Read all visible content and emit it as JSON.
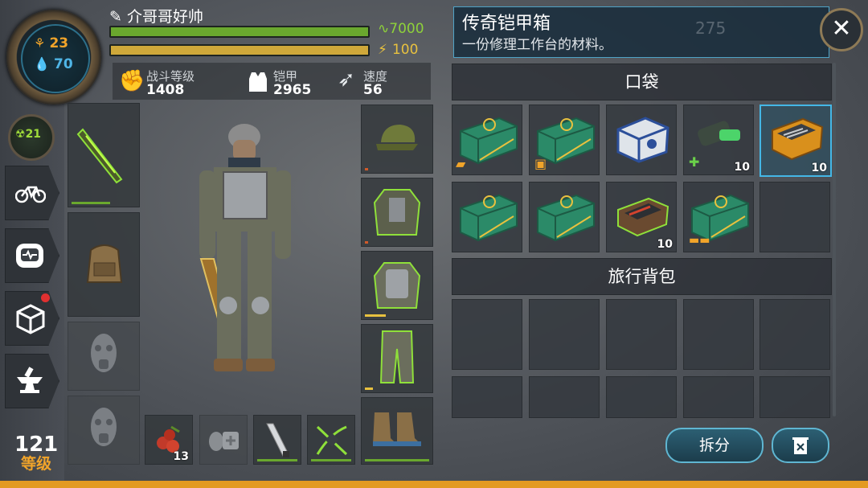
{
  "player": {
    "name": "介哥哥好帅",
    "hunger": "23",
    "thirst": "70",
    "radiation": "21",
    "level": "121",
    "level_label": "等级"
  },
  "bars": {
    "health": "7000",
    "energy": "100"
  },
  "stats": [
    {
      "label": "战斗等级",
      "value": "1408"
    },
    {
      "label": "铠甲",
      "value": "2965"
    },
    {
      "label": "速度",
      "value": "56"
    }
  ],
  "selected_item": {
    "title": "传奇铠甲箱",
    "description": "一份修理工作台的材料。",
    "faded_value": "275"
  },
  "sections": {
    "pocket": "口袋",
    "backpack": "旅行背包"
  },
  "pocket_items": [
    {
      "name": "green-crate-weapon",
      "count": "",
      "badge": "pistol"
    },
    {
      "name": "green-crate-armor",
      "count": "",
      "badge": "vest"
    },
    {
      "name": "blue-chest",
      "count": ""
    },
    {
      "name": "green-device",
      "count": "10",
      "badge": "medkit"
    },
    {
      "name": "toolbox-orange",
      "count": "10",
      "selected": true
    },
    {
      "name": "green-crate-plain",
      "count": ""
    },
    {
      "name": "green-crate-plain-2",
      "count": ""
    },
    {
      "name": "tool-kit-red",
      "count": "10"
    },
    {
      "name": "green-crate-gold",
      "count": "",
      "badge": "gold"
    },
    {
      "name": "empty",
      "count": ""
    }
  ],
  "quick_slots": [
    {
      "name": "rose-hip",
      "count": "13"
    },
    {
      "name": "empty-grenade-medkit",
      "count": ""
    },
    {
      "name": "machete",
      "count": ""
    },
    {
      "name": "crossbow",
      "count": ""
    }
  ],
  "buttons": {
    "split": "拆分",
    "discard_icon": "trash-icon"
  },
  "colors": {
    "accent": "#44b7e6",
    "health": "#8fd23a",
    "energy": "#e8c13f",
    "level": "#f1a42a"
  }
}
